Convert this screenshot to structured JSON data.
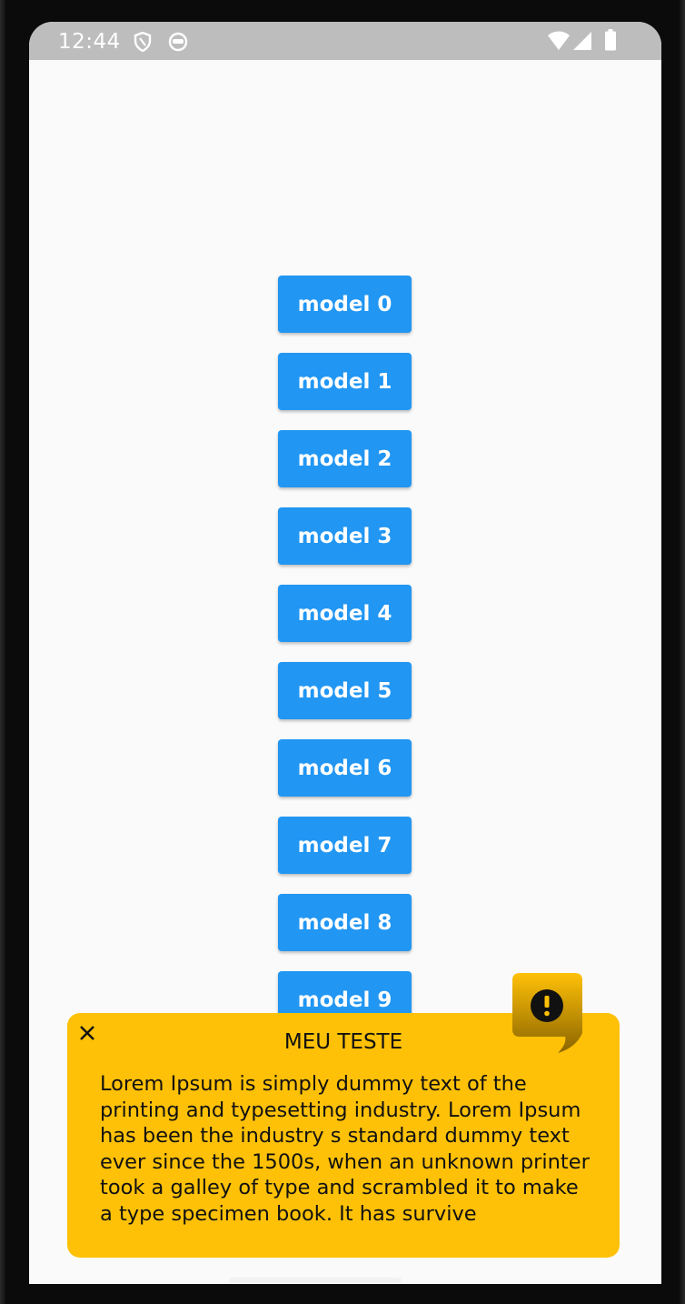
{
  "status_bar": {
    "time": "12:44",
    "icons": [
      "shield-icon",
      "robot-face-icon",
      "wifi-icon",
      "signal-icon",
      "battery-icon"
    ]
  },
  "models": [
    {
      "label": "model 0"
    },
    {
      "label": "model 1"
    },
    {
      "label": "model 2"
    },
    {
      "label": "model 3"
    },
    {
      "label": "model 4"
    },
    {
      "label": "model 5"
    },
    {
      "label": "model 6"
    },
    {
      "label": "model 7"
    },
    {
      "label": "model 8"
    },
    {
      "label": "model 9"
    }
  ],
  "popup": {
    "title": "MEU TESTE",
    "body": "Lorem Ipsum is simply dummy text of the printing and typesetting industry. Lorem Ipsum has been the industry s standard dummy text ever since the 1500s, when an unknown printer took a galley of type and scrambled it to make a type specimen book. It has survive",
    "badge_icon": "exclamation-icon",
    "close_icon": "close-icon"
  },
  "colors": {
    "button": "#2196f3",
    "popup_background": "#ffc107",
    "status_bar": "#bdbdbd",
    "screen_background": "#fafafa"
  }
}
